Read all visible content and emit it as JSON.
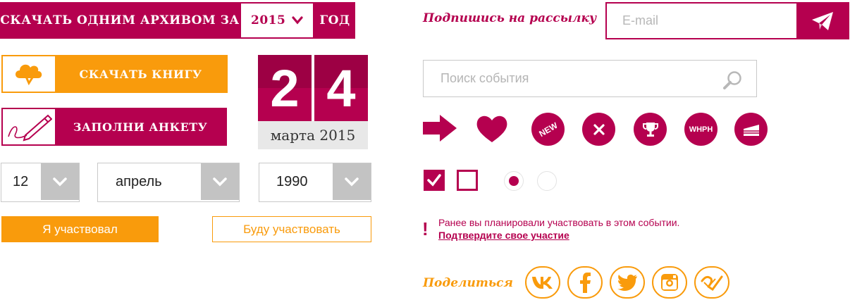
{
  "archive": {
    "label": "СКАЧАТЬ ОДНИМ АРХИВОМ ЗА",
    "year": "2015",
    "suffix": "ГОД"
  },
  "download_book": {
    "label": "СКАЧАТЬ КНИГУ",
    "icon": "cloud-download-icon"
  },
  "fill_form": {
    "label": "ЗАПОЛНИ АНКЕТУ",
    "icon": "pencil-icon"
  },
  "date": {
    "digit1": "2",
    "digit2": "4",
    "caption": "марта 2015"
  },
  "selects": {
    "day": "12",
    "month": "апрель",
    "year": "1990"
  },
  "buttons": {
    "participated": "Я участвовал",
    "will_participate": "Буду участвовать"
  },
  "subscribe": {
    "label": "Подпишись на рассылку",
    "placeholder": "E-mail",
    "send_icon": "paper-plane-icon"
  },
  "search": {
    "placeholder": "Поиск события",
    "icon": "magnifier-icon"
  },
  "icons": {
    "arrow": "arrow-right-icon",
    "heart": "heart-icon",
    "new_label": "NEW",
    "close": "close-icon",
    "trophy": "trophy-icon",
    "whph_label": "WHPH",
    "cake": "cake-icon"
  },
  "controls": {
    "checkbox_checked": true,
    "checkbox_unchecked": false,
    "radio_selected": true,
    "radio_unselected": false
  },
  "notice": {
    "mark": "!",
    "text": "Ранее вы планировали участвовать в этом событии.",
    "link": "Подтвердите свое участие"
  },
  "share": {
    "label": "Поделиться",
    "networks": [
      "vk-icon",
      "facebook-icon",
      "twitter-icon",
      "instagram-icon",
      "odnoklassniki-icon"
    ]
  },
  "colors": {
    "accent": "#b5004f",
    "orange": "#f99b0c",
    "gray": "#c3c3c3"
  }
}
